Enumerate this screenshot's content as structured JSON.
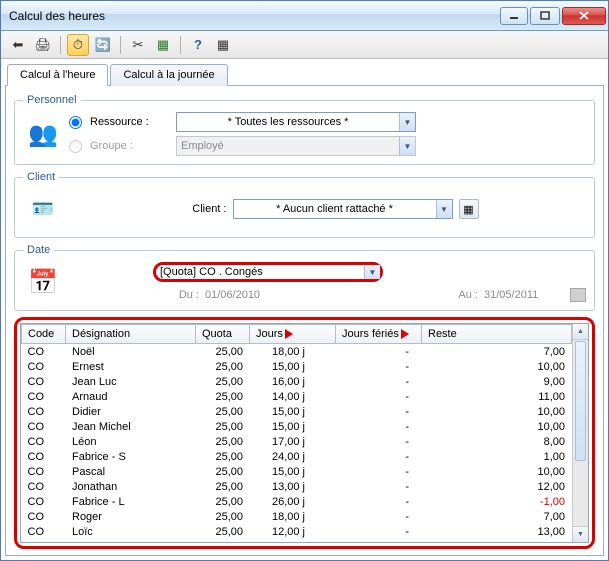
{
  "window": {
    "title": "Calcul des heures"
  },
  "tabs": {
    "hour": "Calcul à l'heure",
    "day": "Calcul à la journée"
  },
  "personnel": {
    "legend": "Personnel",
    "resource_label": "Ressource :",
    "group_label": "Groupe :",
    "resource_value": "* Toutes les ressources *",
    "group_value": "Employé"
  },
  "client": {
    "legend": "Client",
    "label": "Client :",
    "value": "* Aucun client rattaché *"
  },
  "date": {
    "legend": "Date",
    "quota_value": "[Quota] CO . Congés",
    "from_label": "Du :",
    "from_value": "01/06/2010",
    "to_label": "Au :",
    "to_value": "31/05/2011"
  },
  "columns": {
    "code": "Code",
    "designation": "Désignation",
    "quota": "Quota",
    "jours": "Jours",
    "feries": "Jours fériés",
    "reste": "Reste"
  },
  "chart_data": {
    "type": "table",
    "columns": [
      "Code",
      "Désignation",
      "Quota",
      "Jours",
      "Jours fériés",
      "Reste"
    ],
    "rows": [
      {
        "code": "CO",
        "des": "Noël",
        "quota": "25,00",
        "jours": "18,00 j",
        "ferie": "-",
        "reste": "7,00"
      },
      {
        "code": "CO",
        "des": "Ernest",
        "quota": "25,00",
        "jours": "15,00 j",
        "ferie": "-",
        "reste": "10,00"
      },
      {
        "code": "CO",
        "des": "Jean Luc",
        "quota": "25,00",
        "jours": "16,00 j",
        "ferie": "-",
        "reste": "9,00"
      },
      {
        "code": "CO",
        "des": "Arnaud",
        "quota": "25,00",
        "jours": "14,00 j",
        "ferie": "-",
        "reste": "11,00"
      },
      {
        "code": "CO",
        "des": "Didier",
        "quota": "25,00",
        "jours": "15,00 j",
        "ferie": "-",
        "reste": "10,00"
      },
      {
        "code": "CO",
        "des": "Jean Michel",
        "quota": "25,00",
        "jours": "15,00 j",
        "ferie": "-",
        "reste": "10,00"
      },
      {
        "code": "CO",
        "des": "Léon",
        "quota": "25,00",
        "jours": "17,00 j",
        "ferie": "-",
        "reste": "8,00"
      },
      {
        "code": "CO",
        "des": "Fabrice - S",
        "quota": "25,00",
        "jours": "24,00 j",
        "ferie": "-",
        "reste": "1,00"
      },
      {
        "code": "CO",
        "des": "Pascal",
        "quota": "25,00",
        "jours": "15,00 j",
        "ferie": "-",
        "reste": "10,00"
      },
      {
        "code": "CO",
        "des": "Jonathan",
        "quota": "25,00",
        "jours": "13,00 j",
        "ferie": "-",
        "reste": "12,00"
      },
      {
        "code": "CO",
        "des": "Fabrice - L",
        "quota": "25,00",
        "jours": "26,00 j",
        "ferie": "-",
        "reste": "-1,00",
        "neg": true
      },
      {
        "code": "CO",
        "des": "Roger",
        "quota": "25,00",
        "jours": "18,00 j",
        "ferie": "-",
        "reste": "7,00"
      },
      {
        "code": "CO",
        "des": "Loïc",
        "quota": "25,00",
        "jours": "12,00 j",
        "ferie": "-",
        "reste": "13,00"
      }
    ]
  }
}
